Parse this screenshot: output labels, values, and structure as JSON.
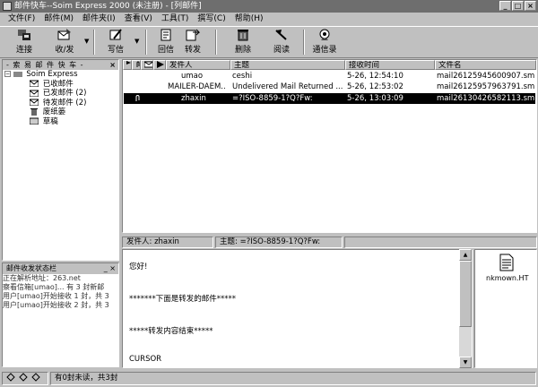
{
  "window": {
    "title": "邮件快车--Soim Express 2000 (未注册) - [列邮件]",
    "controls": [
      "_",
      "□",
      "×"
    ]
  },
  "menu": [
    "文件(F)",
    "邮件(M)",
    "邮件夹(I)",
    "查看(V)",
    "工具(T)",
    "撰写(C)",
    "帮助(H)"
  ],
  "toolbar": {
    "connect": "连接",
    "recv_send": "收/发",
    "write": "写信",
    "reply": "回信",
    "forward": "转发",
    "delete": "删除",
    "read": "阅读",
    "address_book": "通信录"
  },
  "folders": {
    "header": "- 索 易 邮 件 快 车 -",
    "close": "×",
    "root": "Soim Express",
    "items": [
      {
        "label": "已收邮件",
        "count": ""
      },
      {
        "label": "已发邮件",
        "count": "(2)"
      },
      {
        "label": "待发邮件",
        "count": "(2)"
      },
      {
        "label": "废纸篓",
        "count": ""
      },
      {
        "label": "草稿",
        "count": ""
      }
    ]
  },
  "status_pane": {
    "title": "邮件收发状态栏",
    "controls": "_ ×",
    "lines": [
      "正在解析地址：263.net",
      "察看信箱[umao]... 有 3 封新邮",
      "用户[umao]开始接收 1 封，共 3",
      "用户[umao]开始接收 2 封，共 3"
    ]
  },
  "message_list": {
    "columns": {
      "sender": "发件人",
      "subject": "主题",
      "time": "接收时间",
      "file": "文件名"
    },
    "rows": [
      {
        "sender": "umao",
        "subject": "ceshi",
        "time": "5-26, 12:54:10",
        "file": "mail26125945600907.sml",
        "selected": false
      },
      {
        "sender": "MAILER-DAEM..",
        "subject": "Undelivered Mail Returned ...",
        "time": "5-26, 12:53:02",
        "file": "mail26125957963791.sml",
        "selected": false
      },
      {
        "sender": "zhaxin",
        "subject": "=?ISO-8859-1?Q?Fw:",
        "time": "5-26, 13:03:09",
        "file": "mail26130426582113.sml",
        "selected": true
      }
    ]
  },
  "preview": {
    "sender_label": "发件人:",
    "sender": "zhaxin",
    "subject_label": "主题:",
    "subject": "=?ISO-8859-1?Q?Fw:",
    "body_lines": [
      "您好!",
      "*******下面是转发的邮件*****",
      "*****转发内容结束*****",
      "CURSOR"
    ]
  },
  "attachment": {
    "name": "nkmown.HT"
  },
  "statusbar": {
    "text": "有0封未读，共3封"
  }
}
